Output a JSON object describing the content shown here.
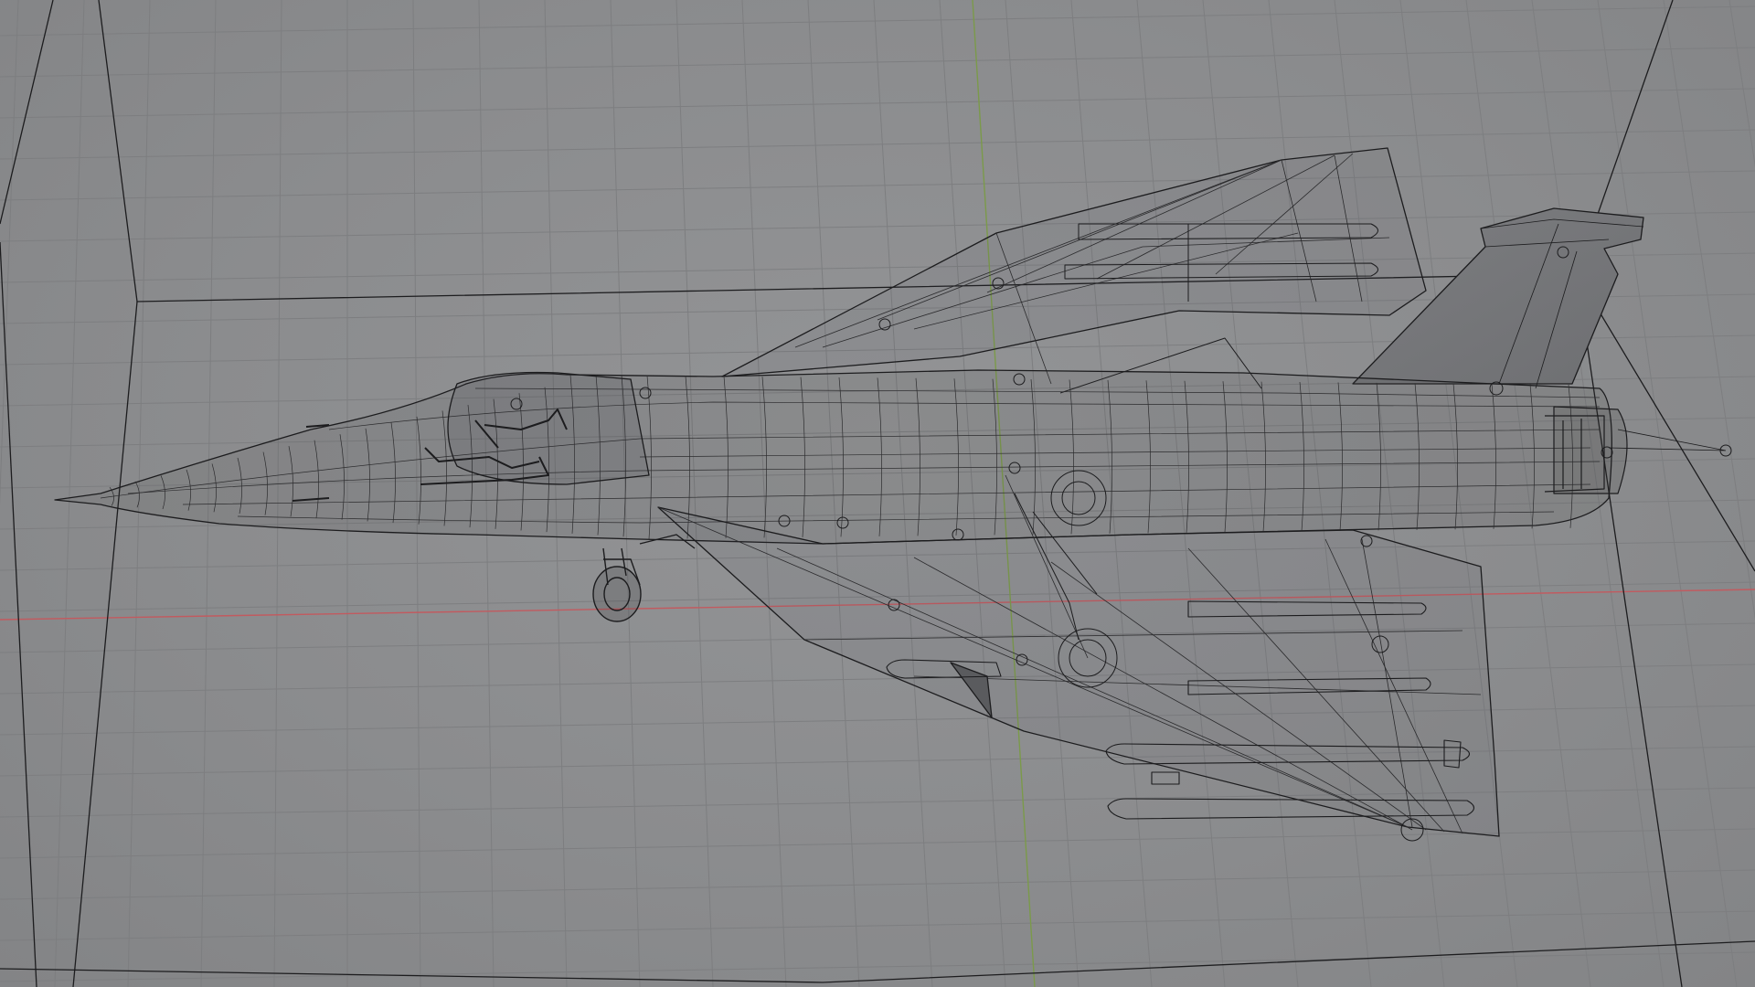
{
  "viewport": {
    "view": "3d-viewport",
    "shading": "wireframe",
    "subject": "delta-wing-jet-model",
    "background_color": "#8b8c8e",
    "grid_color": "#7d7e80",
    "x_axis_color": "#c25a5f",
    "y_axis_color": "#7b9a4a",
    "wire_color": "#1c1c1e"
  }
}
